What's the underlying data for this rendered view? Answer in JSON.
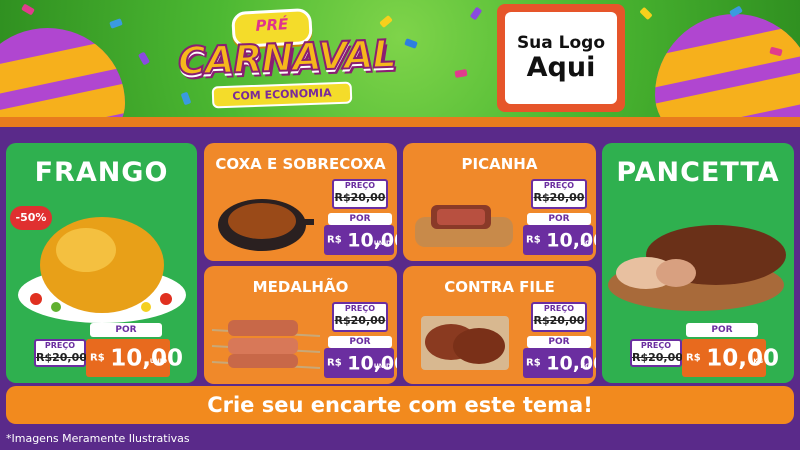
{
  "banner": {
    "pre": "PRÉ",
    "title": "CARNAVAL",
    "subtitle": "COM ECONOMIA",
    "logo_line1": "Sua Logo",
    "logo_line2": "Aqui"
  },
  "products": {
    "frango": {
      "name": "FRANGO",
      "discount": "-50%",
      "old_label": "PREÇO",
      "old_price": "R$20,00",
      "por": "POR",
      "currency": "R$",
      "price": "10,00",
      "unit": "UNID"
    },
    "coxa": {
      "name": "COXA E SOBRECOXA",
      "old_label": "PREÇO",
      "old_price": "R$20,00",
      "por": "POR",
      "currency": "R$",
      "price": "10,00",
      "unit": "UNID"
    },
    "picanha": {
      "name": "PICANHA",
      "old_label": "PREÇO",
      "old_price": "R$20,00",
      "por": "POR",
      "currency": "R$",
      "price": "10,00",
      "unit": "KG"
    },
    "medalhao": {
      "name": "MEDALHÃO",
      "old_label": "PREÇO",
      "old_price": "R$20,00",
      "por": "POR",
      "currency": "R$",
      "price": "10,00",
      "unit": "UNID"
    },
    "contrafile": {
      "name": "CONTRA FILE",
      "old_label": "PREÇO",
      "old_price": "R$20,00",
      "por": "POR",
      "currency": "R$",
      "price": "10,00",
      "unit": "KG"
    },
    "pancetta": {
      "name": "PANCETTA",
      "old_label": "PREÇO",
      "old_price": "R$20,00",
      "por": "POR",
      "currency": "R$",
      "price": "10,00",
      "unit": "KG"
    }
  },
  "cta": "Crie seu encarte com este tema!",
  "disclaimer": "*Imagens Meramente Ilustrativas"
}
